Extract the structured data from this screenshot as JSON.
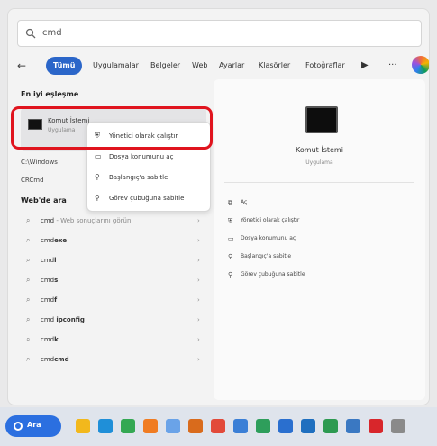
{
  "search": {
    "query": "cmd"
  },
  "filters": {
    "chips": [
      "Tümü",
      "Uygulamalar",
      "Belgeler",
      "Web",
      "Ayarlar",
      "Klasörler",
      "Fotoğraflar"
    ],
    "more": "▶",
    "dots": "···"
  },
  "left": {
    "best_match_title": "En iyi eşleşme",
    "best_match": {
      "name": "Komut İstemi",
      "type": "Uygulama"
    },
    "side_items": [
      "C:\\Windows",
      "CRCmd"
    ],
    "web_title": "Web'de ara",
    "web_results": [
      {
        "prefix": "cmd",
        "bold": "",
        "suffix": " - Web sonuçlarını görün"
      },
      {
        "prefix": "cmd",
        "bold": "exe",
        "suffix": ""
      },
      {
        "prefix": "cmd",
        "bold": "l",
        "suffix": ""
      },
      {
        "prefix": "cmd",
        "bold": "s",
        "suffix": ""
      },
      {
        "prefix": "cmd",
        "bold": "f",
        "suffix": ""
      },
      {
        "prefix": "cmd ",
        "bold": "ipconfig",
        "suffix": ""
      },
      {
        "prefix": "cmd",
        "bold": "k",
        "suffix": ""
      },
      {
        "prefix": "cmd",
        "bold": "cmd",
        "suffix": ""
      }
    ]
  },
  "context_menu": {
    "items": [
      {
        "icon": "shield-icon",
        "label": "Yönetici olarak çalıştır"
      },
      {
        "icon": "folder-icon",
        "label": "Dosya konumunu aç"
      },
      {
        "icon": "pin-icon",
        "label": "Başlangıç'a sabitle"
      },
      {
        "icon": "pin-icon",
        "label": "Görev çubuğuna sabitle"
      }
    ]
  },
  "preview": {
    "title": "Komut İstemi",
    "subtitle": "Uygulama",
    "actions": [
      {
        "icon": "open-icon",
        "label": "Aç"
      },
      {
        "icon": "shield-icon",
        "label": "Yönetici olarak çalıştır"
      },
      {
        "icon": "folder-icon",
        "label": "Dosya konumunu aç"
      },
      {
        "icon": "pin-icon",
        "label": "Başlangıç'a sabitle"
      },
      {
        "icon": "pin-icon",
        "label": "Görev çubuğuna sabitle"
      }
    ]
  },
  "taskbar": {
    "search_label": "Ara",
    "icons": [
      {
        "name": "file-explorer-icon",
        "color": "#f2b81c"
      },
      {
        "name": "edge-icon",
        "color": "#1f8fd8"
      },
      {
        "name": "chrome-icon",
        "color": "#34a853"
      },
      {
        "name": "vlc-icon",
        "color": "#f07c22"
      },
      {
        "name": "windows-icon",
        "color": "#6aa3e8"
      },
      {
        "name": "app-icon",
        "color": "#d96b1c"
      },
      {
        "name": "app-icon-2",
        "color": "#e24a3a"
      },
      {
        "name": "app-icon-3",
        "color": "#3b7fd6"
      },
      {
        "name": "app-icon-4",
        "color": "#2e9e5b"
      },
      {
        "name": "app-icon-5",
        "color": "#2a6fcf"
      },
      {
        "name": "app-icon-6",
        "color": "#1f6fbf"
      },
      {
        "name": "app-icon-7",
        "color": "#2d9a51"
      },
      {
        "name": "app-icon-8",
        "color": "#3a78c2"
      },
      {
        "name": "app-icon-9",
        "color": "#d8262b"
      },
      {
        "name": "app-icon-10",
        "color": "#8a8a8a"
      }
    ]
  }
}
